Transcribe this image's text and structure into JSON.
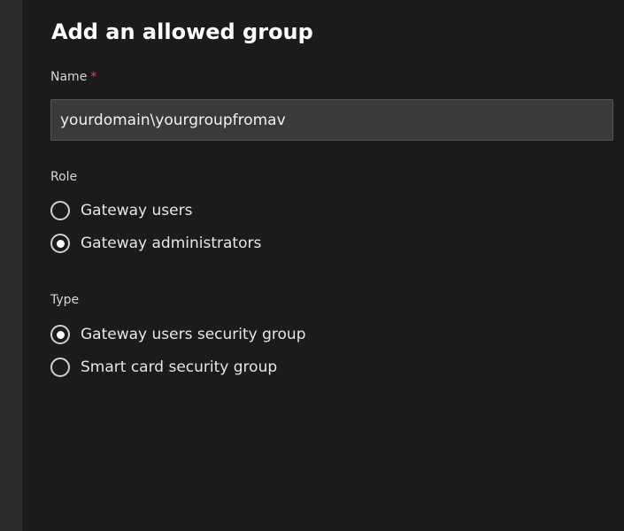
{
  "dialog": {
    "title": "Add an allowed group"
  },
  "name_field": {
    "label": "Name",
    "required_marker": "*",
    "value": "yourdomain\\yourgroupfromav"
  },
  "role": {
    "label": "Role",
    "options": [
      {
        "label": "Gateway users",
        "selected": false
      },
      {
        "label": "Gateway administrators",
        "selected": true
      }
    ]
  },
  "type": {
    "label": "Type",
    "options": [
      {
        "label": "Gateway users security group",
        "selected": true
      },
      {
        "label": "Smart card security group",
        "selected": false
      }
    ]
  },
  "colors": {
    "background": "#1b1b1b",
    "left_rail": "#2b2b2b",
    "input_background": "#3a3a3a",
    "required": "#e74856",
    "text": "#e6e6e6"
  }
}
